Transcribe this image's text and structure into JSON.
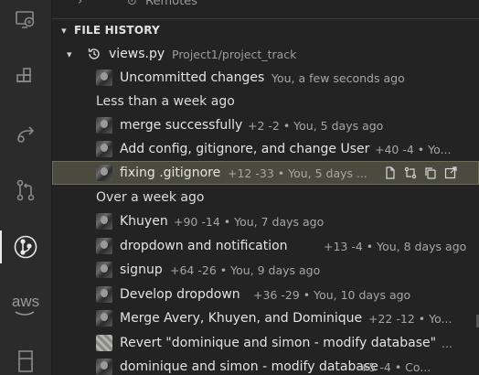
{
  "activity_bar": {
    "items": [
      {
        "name": "remote-explorer-icon"
      },
      {
        "name": "extensions-icon"
      },
      {
        "name": "live-share-icon"
      },
      {
        "name": "source-control-icon"
      },
      {
        "name": "gitlens-icon"
      },
      {
        "name": "aws-icon",
        "label": "aws"
      },
      {
        "name": "database-icon"
      }
    ]
  },
  "partial_row": {
    "label": "Remotes"
  },
  "section": {
    "title": "FILE HISTORY"
  },
  "file": {
    "name": "views.py",
    "path": "Project1/project_track"
  },
  "uncommitted": {
    "message": "Uncommitted changes",
    "meta": "You, a few seconds ago"
  },
  "groups": [
    {
      "label": "Less than a week ago",
      "commits": [
        {
          "message": "merge successfully",
          "meta": "+2 -2 • You, 5 days ago",
          "avatar": "photo"
        },
        {
          "message": "Add config, gitignore, and change User",
          "meta": "+40 -4 • Yo...",
          "avatar": "photo"
        },
        {
          "message": "fixing .gitignore",
          "meta": "+12 -33 • You, 5 days ...",
          "avatar": "photo",
          "selected": true
        }
      ]
    },
    {
      "label": "Over a week ago",
      "commits": [
        {
          "message": "Khuyen",
          "meta": "+90 -14 • You, 7 days ago",
          "avatar": "photo"
        },
        {
          "message": "dropdown and notification",
          "meta": "+13 -4 • You, 8 days ago",
          "avatar": "photo"
        },
        {
          "message": "signup",
          "meta": "+64 -26 • You, 9 days ago",
          "avatar": "photo"
        },
        {
          "message": "Develop dropdown",
          "meta": "+36 -29 • You, 10 days ago",
          "avatar": "photo"
        },
        {
          "message": "Merge Avery, Khuyen, and Dominique",
          "meta": "+22 -12 • Yo...",
          "avatar": "photo"
        },
        {
          "message": "Revert \"dominique and simon - modify database\"",
          "meta": "...",
          "avatar": "pixel"
        },
        {
          "message": "dominique and simon - modify database",
          "meta": "+5 -4 • Co...",
          "avatar": "photo"
        }
      ]
    }
  ],
  "row_actions": [
    {
      "name": "open-file-icon"
    },
    {
      "name": "compare-changes-icon"
    },
    {
      "name": "copy-icon"
    },
    {
      "name": "open-external-icon"
    }
  ]
}
